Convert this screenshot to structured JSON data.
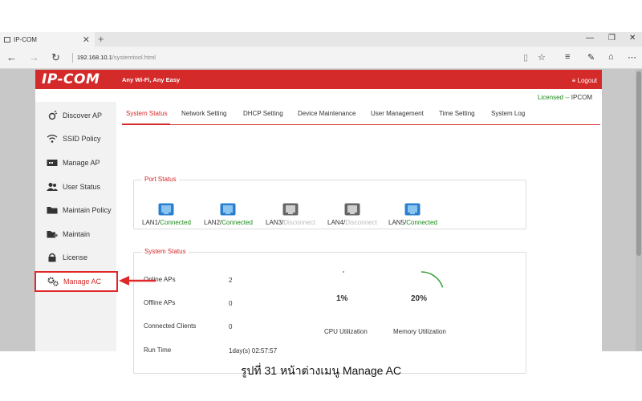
{
  "browser": {
    "tab_title": "IP-COM",
    "url_host": "192.168.10.1",
    "url_path": "/systemtool.html"
  },
  "app": {
    "logo": "IP-COM",
    "tagline": "Any Wi-Fi, Any Easy",
    "logout": "Logout",
    "license_status": "Licensed --",
    "license_name": "IPCOM",
    "brand_color": "#d42a2a"
  },
  "sidebar": {
    "items": [
      {
        "label": "Discover AP",
        "icon": "satellite-icon"
      },
      {
        "label": "SSID Policy",
        "icon": "wifi-icon"
      },
      {
        "label": "Manage AP",
        "icon": "access-point-icon"
      },
      {
        "label": "User Status",
        "icon": "users-icon"
      },
      {
        "label": "Maintain Policy",
        "icon": "folder-icon"
      },
      {
        "label": "Maintain",
        "icon": "folder-tools-icon"
      },
      {
        "label": "License",
        "icon": "lock-icon"
      },
      {
        "label": "Manage AC",
        "icon": "gears-icon"
      }
    ],
    "active": "Manage AC"
  },
  "tabs": [
    "System Status",
    "Network Setting",
    "DHCP Setting",
    "Device Maintenance",
    "User Management",
    "Time Setting",
    "System Log"
  ],
  "port_status": {
    "title": "Port Status",
    "ports": [
      {
        "name": "LAN1/",
        "state": "Connected",
        "connected": true
      },
      {
        "name": "LAN2/",
        "state": "Connected",
        "connected": true
      },
      {
        "name": "LAN3/",
        "state": "Disconnect",
        "connected": false
      },
      {
        "name": "LAN4/",
        "state": "Disconnect",
        "connected": false
      },
      {
        "name": "LAN5/",
        "state": "Connected",
        "connected": true
      }
    ]
  },
  "system_status": {
    "title": "System Status",
    "rows": [
      {
        "label": "Online APs",
        "value": "2"
      },
      {
        "label": "Offline APs",
        "value": "0"
      },
      {
        "label": "Connected Clients",
        "value": "0"
      },
      {
        "label": "Run Time",
        "value": "1day(s) 02:57:57"
      }
    ],
    "cpu": {
      "value": "1%",
      "label": "CPU Utilization",
      "fraction": 0.01
    },
    "memory": {
      "value": "20%",
      "label": "Memory Utilization",
      "fraction": 0.2
    }
  },
  "caption": "รูปที่ 31 หน้าต่างเมนู Manage AC"
}
